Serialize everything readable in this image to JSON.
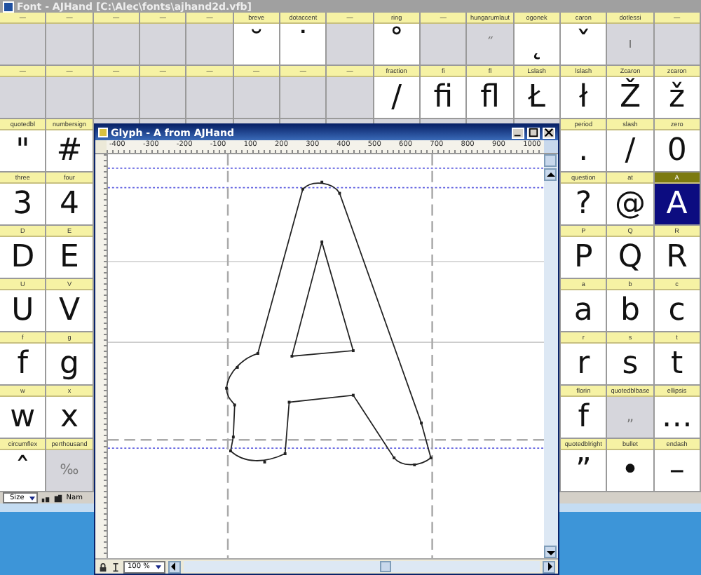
{
  "font_window": {
    "title": "Font - AJHand [C:\\Alec\\fonts\\ajhand2d.vfb]",
    "rows": [
      {
        "left": [
          {
            "label": "—",
            "empty": true,
            "selected": false
          },
          {
            "label": "—",
            "empty": true,
            "selected": false
          },
          {
            "label": "—",
            "empty": true,
            "selected": false
          },
          {
            "label": "—",
            "empty": true,
            "selected": false
          },
          {
            "label": "—",
            "empty": true,
            "selected": false
          },
          {
            "label": "breve",
            "glyph": "˘",
            "empty": false,
            "selected": false
          },
          {
            "label": "dotaccent",
            "glyph": "˙",
            "empty": false,
            "selected": false
          },
          {
            "label": "—",
            "empty": true,
            "selected": false
          },
          {
            "label": "ring",
            "glyph": "˚",
            "empty": false,
            "selected": false
          },
          {
            "label": "—",
            "empty": true,
            "selected": false
          },
          {
            "label": "hungarumlaut",
            "glyph": "˝",
            "empty": true,
            "selected": false
          },
          {
            "label": "ogonek",
            "glyph": "˛",
            "empty": false,
            "selected": false
          },
          {
            "label": "caron",
            "glyph": "ˇ",
            "empty": false,
            "selected": false
          },
          {
            "label": "dotlessi",
            "glyph": "ı",
            "empty": true,
            "selected": false
          },
          {
            "label": "—",
            "empty": true,
            "selected": false
          }
        ],
        "right": []
      },
      {
        "left": [
          {
            "label": "—",
            "empty": true,
            "selected": false
          },
          {
            "label": "—",
            "empty": true,
            "selected": false
          },
          {
            "label": "—",
            "empty": true,
            "selected": false
          },
          {
            "label": "—",
            "empty": true,
            "selected": false
          },
          {
            "label": "—",
            "empty": true,
            "selected": false
          },
          {
            "label": "—",
            "empty": true,
            "selected": false
          },
          {
            "label": "—",
            "empty": true,
            "selected": false
          },
          {
            "label": "—",
            "empty": true,
            "selected": false
          },
          {
            "label": "fraction",
            "glyph": "/",
            "empty": false,
            "selected": false
          },
          {
            "label": "fi",
            "glyph": "fi",
            "empty": false,
            "selected": false
          },
          {
            "label": "fl",
            "glyph": "fl",
            "empty": false,
            "selected": false
          },
          {
            "label": "Lslash",
            "glyph": "Ł",
            "empty": false,
            "selected": false
          },
          {
            "label": "lslash",
            "glyph": "ł",
            "empty": false,
            "selected": false
          },
          {
            "label": "Zcaron",
            "glyph": "Ž",
            "empty": false,
            "selected": false
          },
          {
            "label": "zcaron",
            "glyph": "ž",
            "empty": false,
            "selected": false
          }
        ],
        "right": []
      },
      {
        "left": [
          {
            "label": "quotedbl",
            "glyph": "\"",
            "empty": false,
            "selected": false
          },
          {
            "label": "numbersign",
            "glyph": "#",
            "empty": false,
            "selected": false
          }
        ],
        "right": [
          {
            "label": "period",
            "glyph": ".",
            "empty": false,
            "selected": false
          },
          {
            "label": "slash",
            "glyph": "/",
            "empty": false,
            "selected": false
          },
          {
            "label": "zero",
            "glyph": "0",
            "empty": false,
            "selected": false
          }
        ]
      },
      {
        "left": [
          {
            "label": "three",
            "glyph": "3",
            "empty": false,
            "selected": false
          },
          {
            "label": "four",
            "glyph": "4",
            "empty": false,
            "selected": false
          }
        ],
        "right": [
          {
            "label": "question",
            "glyph": "?",
            "empty": false,
            "selected": false
          },
          {
            "label": "at",
            "glyph": "@",
            "empty": false,
            "selected": false
          },
          {
            "label": "A",
            "glyph": "A",
            "empty": false,
            "selected": true
          }
        ]
      },
      {
        "left": [
          {
            "label": "D",
            "glyph": "D",
            "empty": false,
            "selected": false
          },
          {
            "label": "E",
            "glyph": "E",
            "empty": false,
            "selected": false
          }
        ],
        "right": [
          {
            "label": "P",
            "glyph": "P",
            "empty": false,
            "selected": false
          },
          {
            "label": "Q",
            "glyph": "Q",
            "empty": false,
            "selected": false
          },
          {
            "label": "R",
            "glyph": "R",
            "empty": false,
            "selected": false
          }
        ]
      },
      {
        "left": [
          {
            "label": "U",
            "glyph": "U",
            "empty": false,
            "selected": false
          },
          {
            "label": "V",
            "glyph": "V",
            "empty": false,
            "selected": false
          }
        ],
        "right": [
          {
            "label": "a",
            "glyph": "a",
            "empty": false,
            "selected": false
          },
          {
            "label": "b",
            "glyph": "b",
            "empty": false,
            "selected": false
          },
          {
            "label": "c",
            "glyph": "c",
            "empty": false,
            "selected": false
          }
        ]
      },
      {
        "left": [
          {
            "label": "f",
            "glyph": "f",
            "empty": false,
            "selected": false
          },
          {
            "label": "g",
            "glyph": "g",
            "empty": false,
            "selected": false
          }
        ],
        "right": [
          {
            "label": "r",
            "glyph": "r",
            "empty": false,
            "selected": false
          },
          {
            "label": "s",
            "glyph": "s",
            "empty": false,
            "selected": false
          },
          {
            "label": "t",
            "glyph": "t",
            "empty": false,
            "selected": false
          }
        ]
      },
      {
        "left": [
          {
            "label": "w",
            "glyph": "w",
            "empty": false,
            "selected": false
          },
          {
            "label": "x",
            "glyph": "x",
            "empty": false,
            "selected": false
          }
        ],
        "right": [
          {
            "label": "florin",
            "glyph": "f",
            "empty": false,
            "selected": false
          },
          {
            "label": "quotedblbase",
            "glyph": "„",
            "empty": true,
            "selected": false
          },
          {
            "label": "ellipsis",
            "glyph": "…",
            "empty": false,
            "selected": false
          }
        ]
      },
      {
        "left": [
          {
            "label": "circumflex",
            "glyph": "ˆ",
            "empty": false,
            "selected": false
          },
          {
            "label": "perthousand",
            "glyph": "‰",
            "empty": true,
            "selected": false
          }
        ],
        "right": [
          {
            "label": "quotedblright",
            "glyph": "”",
            "empty": false,
            "selected": false
          },
          {
            "label": "bullet",
            "glyph": "•",
            "empty": false,
            "selected": false
          },
          {
            "label": "endash",
            "glyph": "–",
            "empty": false,
            "selected": false
          }
        ]
      }
    ],
    "toolbar": {
      "size_select": "Size",
      "name_label": "Nam"
    }
  },
  "glyph_window": {
    "title": "Glyph - A from AJHand",
    "ruler_labels": [
      "-400",
      "-300",
      "-200",
      "-100",
      "100",
      "200",
      "300",
      "400",
      "500",
      "600",
      "700",
      "800",
      "900",
      "1000"
    ],
    "zoom_select": "100 %"
  }
}
